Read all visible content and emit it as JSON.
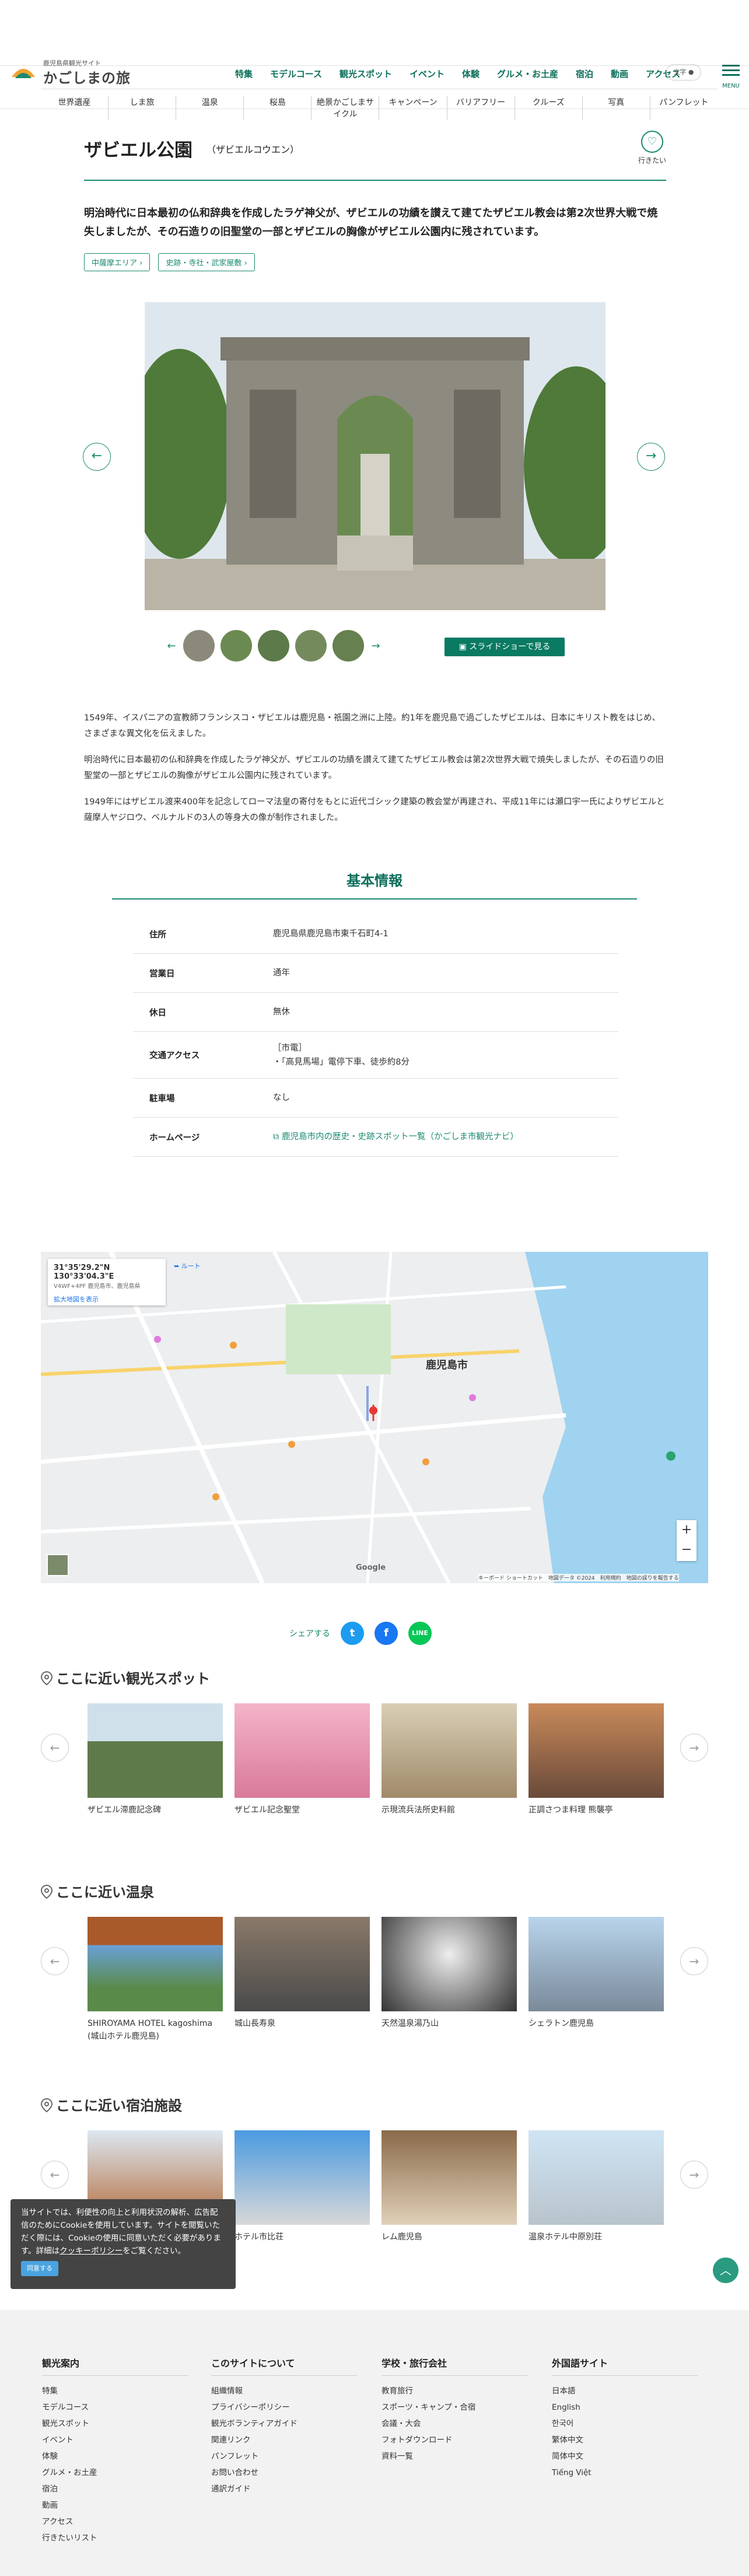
{
  "header": {
    "logo_small": "鹿児島県観光サイト",
    "logo_main": "かごしまの旅",
    "lang": "文字",
    "menu": "MENU",
    "nav": [
      "特集",
      "モデルコース",
      "観光スポット",
      "イベント",
      "体験",
      "グルメ・お土産",
      "宿泊",
      "動画",
      "アクセス"
    ],
    "subnav": [
      "世界遺産",
      "しま旅",
      "温泉",
      "桜島",
      "絶景かごしまサイクル",
      "キャンペーン",
      "バリアフリー",
      "クルーズ",
      "写真",
      "パンフレット"
    ]
  },
  "page": {
    "title": "ザビエル公園",
    "ruby": "（ザビエルコウエン）",
    "fav_label": "行きたい",
    "lead": "明治時代に日本最初の仏和辞典を作成したラゲ神父が、ザビエルの功績を讃えて建てたザビエル教会は第2次世界大戦で焼失しましたが、その石造りの旧聖堂の一部とザビエルの胸像がザビエル公園内に残されています。",
    "tags": [
      "中薩摩エリア",
      "史跡・寺社・武家屋敷"
    ],
    "slideshow": "スライドショーで見る",
    "desc": [
      "1549年、イスパニアの宣教師フランシスコ・ザビエルは鹿児島・祇園之洲に上陸。約1年を鹿児島で過ごしたザビエルは、日本にキリスト教をはじめ、さまざまな異文化を伝えました。",
      "明治時代に日本最初の仏和辞典を作成したラゲ神父が、ザビエルの功績を讃えて建てたザビエル教会は第2次世界大戦で焼失しましたが、その石造りの旧聖堂の一部とザビエルの胸像がザビエル公園内に残されています。",
      "1949年にはザビエル渡来400年を記念してローマ法皇の寄付をもとに近代ゴシック建築の教会堂が再建され、平成11年には瀬口宇一氏によりザビエルと薩摩人ヤジロウ、ベルナルドの3人の等身大の像が制作されました。"
    ]
  },
  "basic": {
    "title": "基本情報",
    "rows": [
      {
        "k": "住所",
        "v": "鹿児島県鹿児島市東千石町4-1"
      },
      {
        "k": "営業日",
        "v": "通年"
      },
      {
        "k": "休日",
        "v": "無休"
      },
      {
        "k": "交通アクセス",
        "v": "［市電］",
        "v2": "・「高見馬場」電停下車、徒歩約8分"
      },
      {
        "k": "駐車場",
        "v": "なし"
      },
      {
        "k": "ホームページ",
        "v": "鹿児島市内の歴史・史跡スポット一覧（かごしま市観光ナビ）"
      }
    ]
  },
  "map": {
    "coords": "31°35'29.2\"N 130°33'04.3\"E",
    "address": "V4WF+4PF 鹿児島市、鹿児島県",
    "route": "ルート",
    "enlarge": "拡大地図を表示",
    "city": "鹿児島市",
    "google": "Google",
    "attribution": "キーボード ショートカット　地図データ ©2024　利用規約　地図の誤りを報告する"
  },
  "share": {
    "label": "シェアする"
  },
  "near_spots": {
    "title": "ここに近い観光スポット",
    "items": [
      "ザビエル滞鹿記念碑",
      "ザビエル記念聖堂",
      "示現流兵法所史料館",
      "正調さつま料理 熊襲亭"
    ]
  },
  "near_onsen": {
    "title": "ここに近い温泉",
    "items": [
      "SHIROYAMA HOTEL kagoshima\n(城山ホテル鹿児島)",
      "城山長寿泉",
      "天然温泉湯乃山",
      "シェラトン鹿児島"
    ]
  },
  "near_hotel": {
    "title": "ここに近い宿泊施設",
    "items": [
      "",
      "ホテル市比荘",
      "レム鹿児島",
      "温泉ホテル中原別荘"
    ]
  },
  "cookie": {
    "text": "当サイトでは、利便性の向上と利用状況の解析、広告配信のためにCookieを使用しています。サイトを閲覧いただく際には、Cookieの使用に同意いただく必要があります。詳細は",
    "link": "クッキーポリシー",
    "text2": "をご覧ください。",
    "btn": "同意する"
  },
  "footer": {
    "cols": [
      {
        "h": "観光案内",
        "items": [
          "特集",
          "モデルコース",
          "観光スポット",
          "イベント",
          "体験",
          "グルメ・お土産",
          "宿泊",
          "動画",
          "アクセス",
          "行きたいリスト"
        ]
      },
      {
        "h": "このサイトについて",
        "items": [
          "組織情報",
          "プライバシーポリシー",
          "観光ボランティアガイド",
          "関連リンク",
          "パンフレット",
          "お問い合わせ",
          "通訳ガイド"
        ]
      },
      {
        "h": "学校・旅行会社",
        "items": [
          "教育旅行",
          "スポーツ・キャンプ・合宿",
          "会議・大会",
          "フォトダウンロード",
          "資料一覧"
        ]
      },
      {
        "h": "外国語サイト",
        "items": [
          "日本語",
          "English",
          "한국어",
          "繁体中文",
          "简体中文",
          "Tiếng Việt"
        ]
      }
    ]
  },
  "colors": {
    "accent": "#1a8a70",
    "nav": "#0a6e5a",
    "twitter": "#1d9bf0",
    "facebook": "#1877f2",
    "line": "#06c755"
  }
}
